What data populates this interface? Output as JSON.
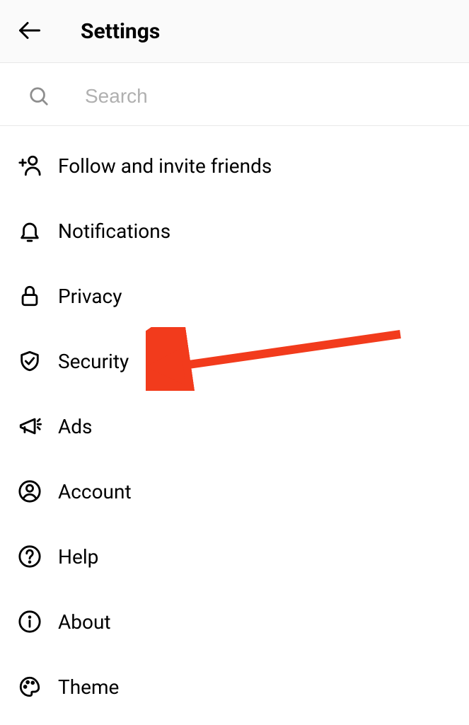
{
  "header": {
    "title": "Settings"
  },
  "search": {
    "placeholder": "Search",
    "value": ""
  },
  "menu": {
    "items": [
      {
        "icon": "add-person-icon",
        "label": "Follow and invite friends"
      },
      {
        "icon": "bell-icon",
        "label": "Notifications"
      },
      {
        "icon": "lock-icon",
        "label": "Privacy"
      },
      {
        "icon": "shield-check-icon",
        "label": "Security"
      },
      {
        "icon": "megaphone-icon",
        "label": "Ads"
      },
      {
        "icon": "person-circle-icon",
        "label": "Account"
      },
      {
        "icon": "question-circle-icon",
        "label": "Help"
      },
      {
        "icon": "info-circle-icon",
        "label": "About"
      },
      {
        "icon": "palette-icon",
        "label": "Theme"
      }
    ]
  },
  "annotation": {
    "color": "#f23b1c"
  }
}
